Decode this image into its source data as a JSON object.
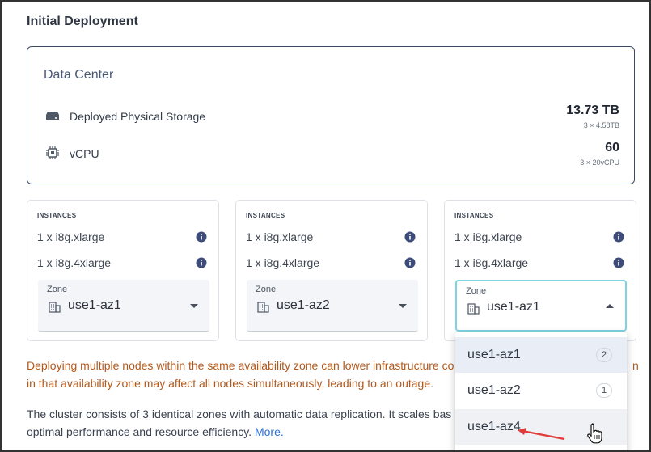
{
  "section_title": "Initial Deployment",
  "data_center": {
    "title": "Data Center",
    "metrics": [
      {
        "icon": "storage-drive-icon",
        "label": "Deployed Physical Storage",
        "value": "13.73 TB",
        "sub": "3 × 4.58TB"
      },
      {
        "icon": "cpu-chip-icon",
        "label": "vCPU",
        "value": "60",
        "sub": "3 × 20vCPU"
      }
    ]
  },
  "instances": [
    {
      "heading": "INSTANCES",
      "lines": [
        "1 x i8g.xlarge",
        "1 x i8g.4xlarge"
      ],
      "zone_label": "Zone",
      "zone_value": "use1-az1"
    },
    {
      "heading": "INSTANCES",
      "lines": [
        "1 x i8g.xlarge",
        "1 x i8g.4xlarge"
      ],
      "zone_label": "Zone",
      "zone_value": "use1-az2"
    },
    {
      "heading": "INSTANCES",
      "lines": [
        "1 x i8g.xlarge",
        "1 x i8g.4xlarge"
      ],
      "zone_label": "Zone",
      "zone_value": "use1-az1"
    }
  ],
  "dropdown": {
    "options": [
      {
        "label": "use1-az1",
        "count": "2"
      },
      {
        "label": "use1-az2",
        "count": "1"
      },
      {
        "label": "use1-az4",
        "count": ""
      }
    ]
  },
  "warning_text": "Deploying multiple nodes within the same availability zone can lower infrastructure co",
  "warning_text_2": "in that availability zone may affect all nodes simultaneously, leading to an outage.",
  "warning_text_tail": "n",
  "info_text": "The cluster consists of 3 identical zones with automatic data replication. It scales bas",
  "info_text_2": "optimal performance and resource efficiency.",
  "more_link": "More.",
  "colors": {
    "accent_link": "#2e6fd3",
    "warning": "#b4581a",
    "focus_border": "#7fd3e3",
    "arrow": "#e03a3a"
  }
}
